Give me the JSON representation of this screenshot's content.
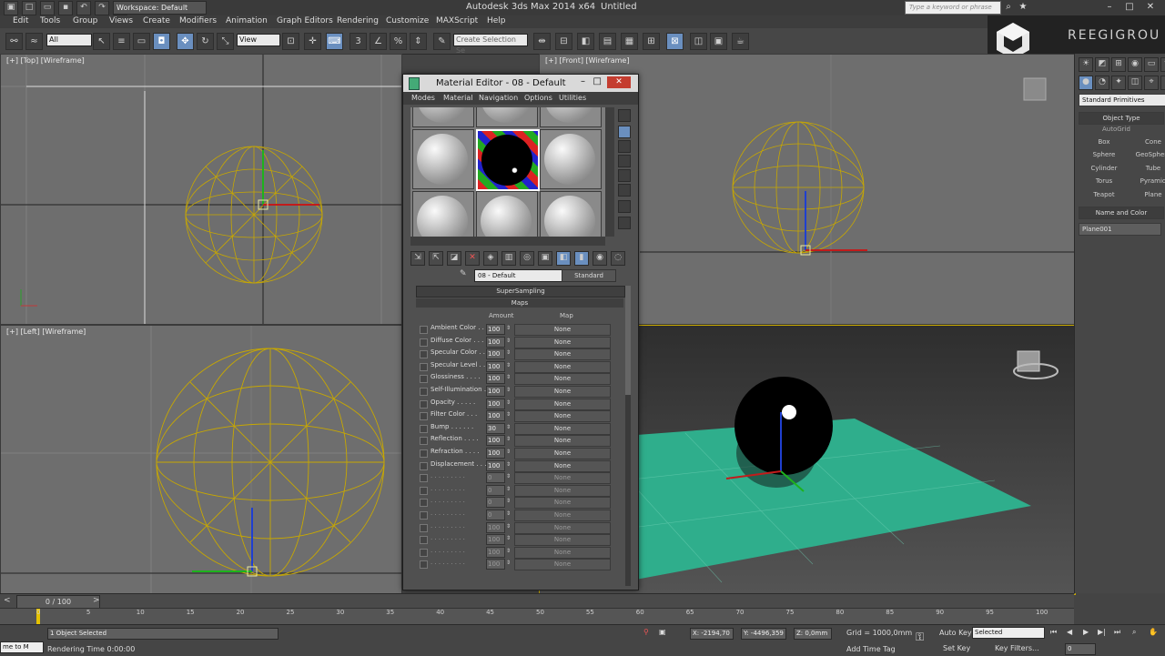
{
  "app": {
    "title": "Autodesk 3ds Max  2014 x64",
    "document": "Untitled",
    "workspace": "Workspace: Default",
    "search_placeholder": "Type a keyword or phrase"
  },
  "menu": [
    "Edit",
    "Tools",
    "Group",
    "Views",
    "Create",
    "Modifiers",
    "Animation",
    "Graph Editors",
    "Rendering",
    "Customize",
    "MAXScript",
    "Help"
  ],
  "toolbar": {
    "selection_filter": "All",
    "ref_coord": "View",
    "named_selection_placeholder": "Create Selection Se"
  },
  "logo": {
    "text": "REEGIGROU"
  },
  "viewports": {
    "top": "[+] [Top] [Wireframe]",
    "front": "[+] [Front] [Wireframe]",
    "left": "[+] [Left] [Wireframe]",
    "perspective": ""
  },
  "command_panel": {
    "category": "Standard Primitives",
    "object_type_title": "Object Type",
    "autogrid": "AutoGrid",
    "buttons": [
      "Box",
      "Cone",
      "Sphere",
      "GeoSphere",
      "Cylinder",
      "Tube",
      "Torus",
      "Pyramid",
      "Teapot",
      "Plane"
    ],
    "name_color_title": "Name and Color",
    "object_name": "Plane001"
  },
  "material_editor": {
    "title": "Material Editor - 08 - Default",
    "menu": [
      "Modes",
      "Material",
      "Navigation",
      "Options",
      "Utilities"
    ],
    "material_name": "08 - Default",
    "material_type": "Standard",
    "rollout_supersampling": "SuperSampling",
    "rollout_maps": "Maps",
    "col_amount": "Amount",
    "col_map": "Map",
    "maps": [
      {
        "label": "Ambient Color . .",
        "amount": "100",
        "map": "None"
      },
      {
        "label": "Diffuse Color . . .",
        "amount": "100",
        "map": "None"
      },
      {
        "label": "Specular Color . .",
        "amount": "100",
        "map": "None"
      },
      {
        "label": "Specular Level . .",
        "amount": "100",
        "map": "None"
      },
      {
        "label": "Glossiness . . . .",
        "amount": "100",
        "map": "None"
      },
      {
        "label": "Self-Illumination .",
        "amount": "100",
        "map": "None"
      },
      {
        "label": "Opacity . . . . .",
        "amount": "100",
        "map": "None"
      },
      {
        "label": "Filter Color . . .",
        "amount": "100",
        "map": "None"
      },
      {
        "label": "Bump . . . . . .",
        "amount": "30",
        "map": "None"
      },
      {
        "label": "Reflection . . . .",
        "amount": "100",
        "map": "None"
      },
      {
        "label": "Refraction . . . .",
        "amount": "100",
        "map": "None"
      },
      {
        "label": "Displacement . . .",
        "amount": "100",
        "map": "None"
      },
      {
        "label": ". . . . . . . . .",
        "amount": "0",
        "map": "None"
      },
      {
        "label": ". . . . . . . . .",
        "amount": "0",
        "map": "None"
      },
      {
        "label": ". . . . . . . . .",
        "amount": "0",
        "map": "None"
      },
      {
        "label": ". . . . . . . . .",
        "amount": "0",
        "map": "None"
      },
      {
        "label": ". . . . . . . . .",
        "amount": "100",
        "map": "None"
      },
      {
        "label": ". . . . . . . . .",
        "amount": "100",
        "map": "None"
      },
      {
        "label": ". . . . . . . . .",
        "amount": "100",
        "map": "None"
      },
      {
        "label": ". . . . . . . . .",
        "amount": "100",
        "map": "None"
      }
    ]
  },
  "timeline": {
    "frame": "0 / 100",
    "ticks": [
      "0",
      "5",
      "10",
      "15",
      "20",
      "25",
      "30",
      "35",
      "40",
      "45",
      "50",
      "55",
      "60",
      "65",
      "70",
      "75",
      "80",
      "85",
      "90",
      "95",
      "100"
    ]
  },
  "status": {
    "selection": "1 Object Selected",
    "render_time": "Rendering Time 0:00:00",
    "maxscript": "me to M",
    "x": "X: -2194,70",
    "y": "Y: -4496,359",
    "z": "Z: 0,0mm",
    "grid": "Grid = 1000,0mm",
    "auto_key": "Auto Key",
    "set_key": "Set Key",
    "key_mode": "Selected",
    "key_filters": "Key Filters...",
    "add_time_tag": "Add Time Tag",
    "frame_field": "0"
  }
}
